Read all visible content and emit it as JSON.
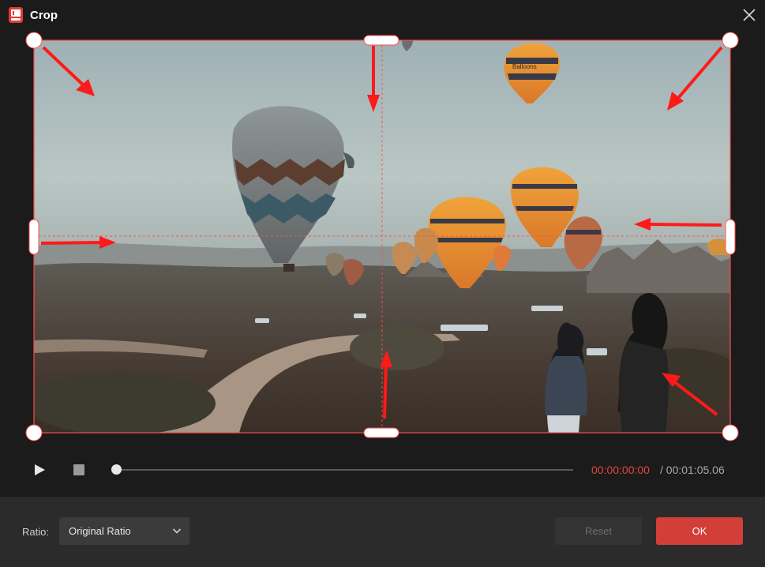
{
  "window": {
    "title": "Crop",
    "close_icon": "close-icon",
    "app_icon": "app-logo-icon"
  },
  "colors": {
    "accent": "#d13f38",
    "crop_frame": "#ff4d4d",
    "time_current": "#e0463f"
  },
  "player": {
    "play_icon": "play-icon",
    "stop_icon": "stop-icon",
    "progress": 0,
    "time_current": "00:00:00:00",
    "time_total": "/ 00:01:05.06"
  },
  "footer": {
    "ratio_label": "Ratio:",
    "ratio_value": "Original Ratio",
    "ratio_icon": "chevron-down-icon",
    "reset_label": "Reset",
    "ok_label": "OK"
  }
}
